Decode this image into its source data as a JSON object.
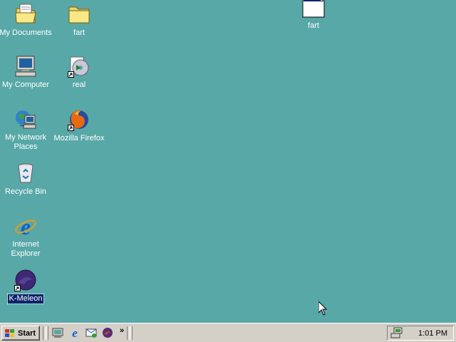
{
  "desktop": {
    "background_color": "#58A8A8",
    "icons": [
      {
        "label": "My Documents",
        "icon": "my-documents-icon"
      },
      {
        "label": "fart",
        "icon": "folder-icon"
      },
      {
        "label": "My Computer",
        "icon": "my-computer-icon"
      },
      {
        "label": "real",
        "icon": "realplayer-icon"
      },
      {
        "label": "My Network Places",
        "icon": "network-places-icon"
      },
      {
        "label": "Mozilla Firefox",
        "icon": "firefox-icon"
      },
      {
        "label": "Recycle Bin",
        "icon": "recycle-bin-icon"
      },
      {
        "label": "Internet Explorer",
        "icon": "internet-explorer-icon"
      },
      {
        "label": "K-Meleon",
        "icon": "k-meleon-icon"
      },
      {
        "label": "fart",
        "icon": "application-window-icon"
      }
    ]
  },
  "taskbar": {
    "start_label": "Start",
    "quick_launch": [
      "show-desktop-icon",
      "internet-explorer-icon",
      "outlook-express-icon",
      "k-meleon-icon"
    ],
    "more_label": "»",
    "clock": "1:01 PM"
  }
}
